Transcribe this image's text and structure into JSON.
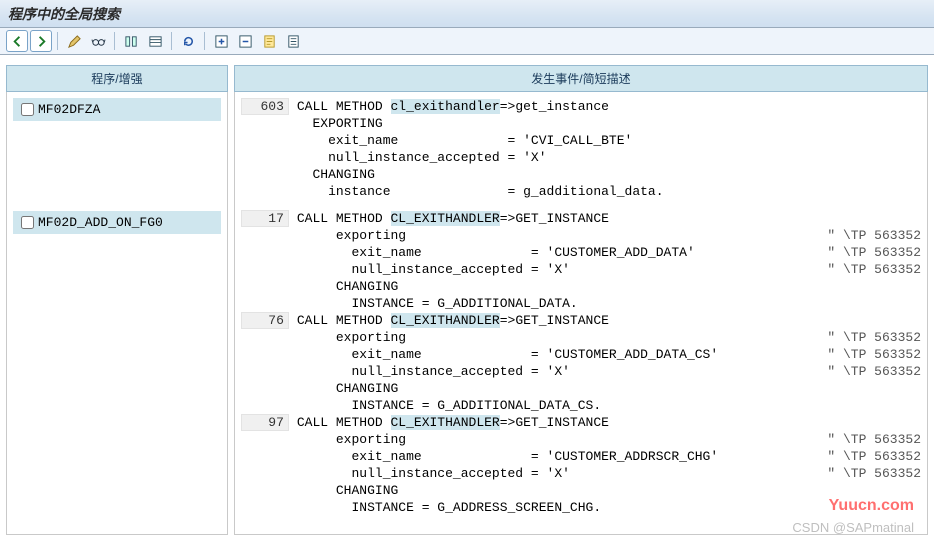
{
  "title": "程序中的全局搜索",
  "columns": {
    "left_header": "程序/增强",
    "right_header": "发生事件/简短描述"
  },
  "programs": [
    {
      "name": "MF02DFZA",
      "checked": false
    },
    {
      "name": "MF02D_ADD_ON_FG0",
      "checked": false
    }
  ],
  "code": [
    {
      "program_index": 0,
      "entries": [
        {
          "lnum": "603",
          "lines": [
            {
              "pre": "CALL METHOD ",
              "hl": "cl_exithandler",
              "post": "=>get_instance"
            },
            {
              "text": "  EXPORTING"
            },
            {
              "text": "    exit_name              = 'CVI_CALL_BTE'"
            },
            {
              "text": "    null_instance_accepted = 'X'"
            },
            {
              "text": "  CHANGING"
            },
            {
              "text": "    instance               = g_additional_data."
            }
          ]
        }
      ]
    },
    {
      "program_index": 1,
      "entries": [
        {
          "lnum": "17",
          "lines": [
            {
              "pre": "CALL METHOD ",
              "hl": "CL_EXITHANDLER",
              "post": "=>GET_INSTANCE"
            },
            {
              "text": "     exporting",
              "cmt": "\" \\TP 563352"
            },
            {
              "text": "       exit_name              = 'CUSTOMER_ADD_DATA'",
              "cmt": "\" \\TP 563352"
            },
            {
              "text": "       null_instance_accepted = 'X'",
              "cmt": "\" \\TP 563352"
            },
            {
              "text": "     CHANGING"
            },
            {
              "text": "       INSTANCE = G_ADDITIONAL_DATA."
            }
          ]
        },
        {
          "lnum": "76",
          "lines": [
            {
              "pre": "CALL METHOD ",
              "hl": "CL_EXITHANDLER",
              "post": "=>GET_INSTANCE"
            },
            {
              "text": "     exporting",
              "cmt": "\" \\TP 563352"
            },
            {
              "text": "       exit_name              = 'CUSTOMER_ADD_DATA_CS'",
              "cmt": "\" \\TP 563352"
            },
            {
              "text": "       null_instance_accepted = 'X'",
              "cmt": "\" \\TP 563352"
            },
            {
              "text": "     CHANGING"
            },
            {
              "text": "       INSTANCE = G_ADDITIONAL_DATA_CS."
            }
          ]
        },
        {
          "lnum": "97",
          "lines": [
            {
              "pre": "CALL METHOD ",
              "hl": "CL_EXITHANDLER",
              "post": "=>GET_INSTANCE"
            },
            {
              "text": "     exporting",
              "cmt": "\" \\TP 563352"
            },
            {
              "text": "       exit_name              = 'CUSTOMER_ADDRSCR_CHG'",
              "cmt": "\" \\TP 563352"
            },
            {
              "text": "       null_instance_accepted = 'X'",
              "cmt": "\" \\TP 563352"
            },
            {
              "text": "     CHANGING"
            },
            {
              "text": "       INSTANCE = G_ADDRESS_SCREEN_CHG."
            }
          ]
        }
      ]
    }
  ],
  "watermarks": {
    "w1": "Yuucn.com",
    "w2": "CSDN @SAPmatinal"
  },
  "icons": [
    "back-icon",
    "forward-icon",
    "pencil-icon",
    "glasses-icon",
    "columns-icon",
    "list-icon",
    "refresh-icon",
    "plus-box-icon",
    "minus-box-icon",
    "note-icon",
    "page-icon"
  ]
}
